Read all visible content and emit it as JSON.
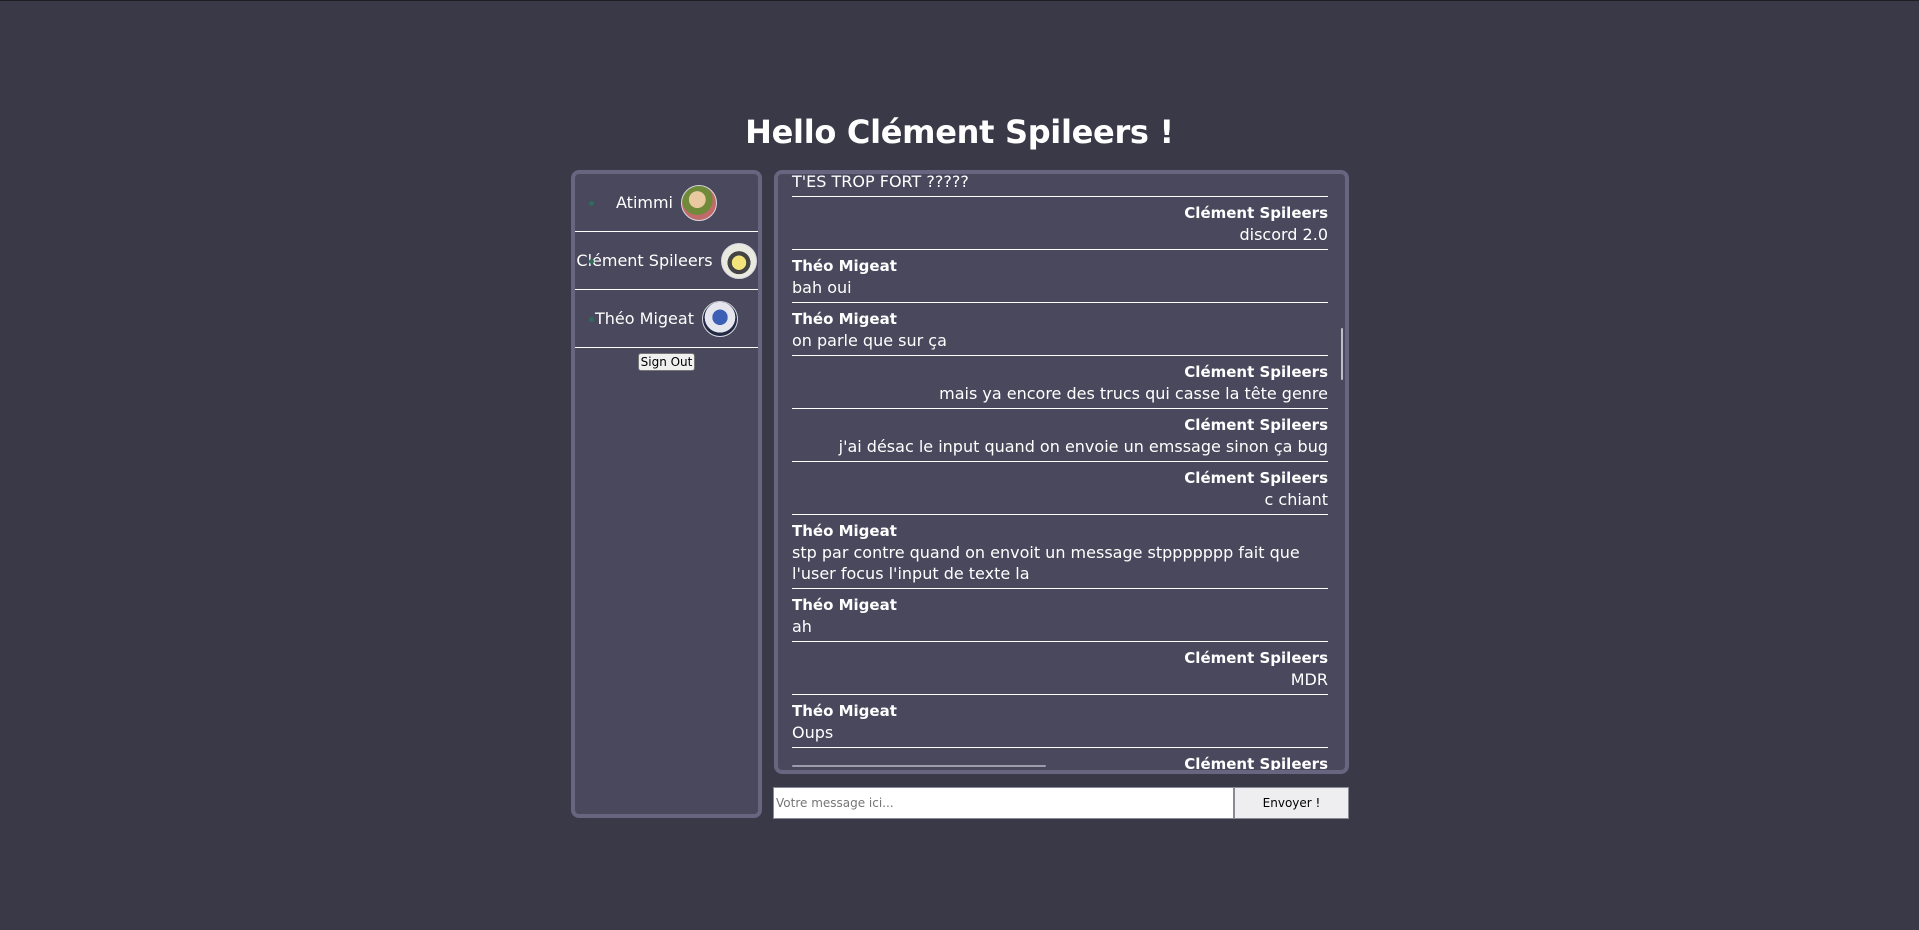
{
  "header": {
    "title": "Hello Clément Spileers !"
  },
  "sidebar": {
    "users": [
      {
        "name": "Atimmi",
        "avatar": "avatar-atimmi"
      },
      {
        "name": "Clément Spileers",
        "avatar": "avatar-clement"
      },
      {
        "name": "Théo Migeat",
        "avatar": "avatar-theo"
      }
    ],
    "sign_out_label": "Sign Out"
  },
  "chat": {
    "messages": [
      {
        "author": "",
        "text": "T'ES TROP FORT ?????",
        "side": "left"
      },
      {
        "author": "Clément Spileers",
        "text": "discord 2.0",
        "side": "right"
      },
      {
        "author": "Théo Migeat",
        "text": "bah oui",
        "side": "left"
      },
      {
        "author": "Théo Migeat",
        "text": "on parle que sur ça",
        "side": "left"
      },
      {
        "author": "Clément Spileers",
        "text": "mais ya encore des trucs qui casse la tête genre",
        "side": "right"
      },
      {
        "author": "Clément Spileers",
        "text": "j'ai désac le input quand on envoie un emssage sinon ça bug",
        "side": "right"
      },
      {
        "author": "Clément Spileers",
        "text": "c chiant",
        "side": "right"
      },
      {
        "author": "Théo Migeat",
        "text": "stp par contre quand on envoit un message stppppppp fait que l'user focus l'input de texte la",
        "side": "left"
      },
      {
        "author": "Théo Migeat",
        "text": "ah",
        "side": "left"
      },
      {
        "author": "Clément Spileers",
        "text": "MDR",
        "side": "right"
      },
      {
        "author": "Théo Migeat",
        "text": "Oups",
        "side": "left"
      },
      {
        "author": "Clément Spileers",
        "text": "",
        "side": "right"
      }
    ]
  },
  "composer": {
    "input_value": "",
    "input_placeholder": "Votre message ici...",
    "send_label": "Envoyer !"
  },
  "colors": {
    "background": "#3a3947",
    "panel": "#4a485c",
    "panel_border": "#67657f",
    "status_dot": "#2f6b5a"
  }
}
